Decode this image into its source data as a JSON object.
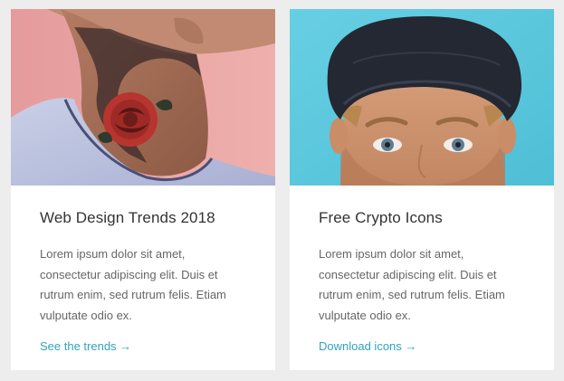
{
  "cards": [
    {
      "title": "Web Design Trends 2018",
      "text": "Lorem ipsum dolor sit amet, consectetur adipiscing elit. Duis et rutrum enim, sed rutrum felis. Etiam vulputate odio ex.",
      "link_label": "See the trends →",
      "image": {
        "background_color": "#e8a1a0",
        "subject": "tattooed-neck-photo"
      }
    },
    {
      "title": "Free Crypto Icons",
      "text": "Lorem ipsum dolor sit amet, consectetur adipiscing elit. Duis et rutrum enim, sed rutrum felis. Etiam vulputate odio ex.",
      "link_label": "Download icons →",
      "image": {
        "background_color": "#5ec8dc",
        "subject": "man-in-cap-photo"
      }
    }
  ],
  "colors": {
    "page_background": "#ededed",
    "card_background": "#ffffff",
    "title": "#333333",
    "text": "#666666",
    "link": "#31a3bd"
  }
}
